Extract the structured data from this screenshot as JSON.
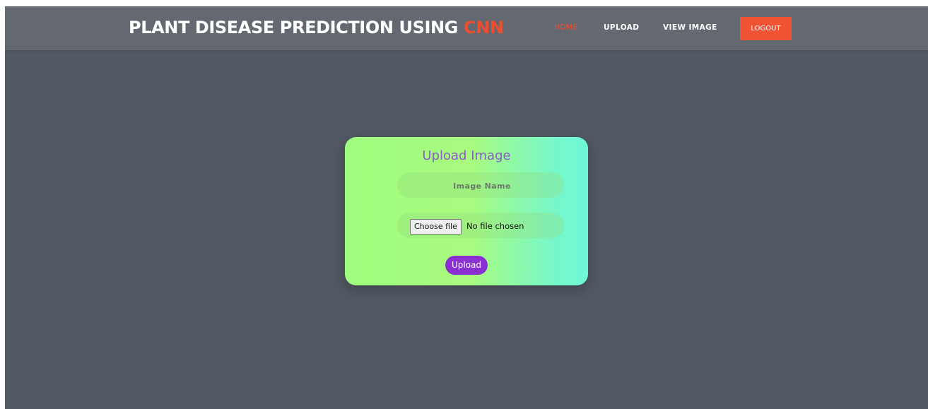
{
  "header": {
    "brand_text": "PLANT DISEASE PREDICTION USING ",
    "brand_accent": "CNN",
    "nav": {
      "home": "HOME",
      "upload": "UPLOAD",
      "view_image": "VIEW IMAGE",
      "logout": "LOGOUT"
    }
  },
  "upload_card": {
    "title": "Upload Image",
    "image_name_placeholder": "Image Name",
    "choose_file_label": "Choose file",
    "file_status": "No file chosen",
    "upload_button": "Upload"
  },
  "colors": {
    "accent": "#ee4e2e",
    "page_bg": "#525964",
    "header_bg": "#636871",
    "upload_button": "#8a2fd1",
    "card_gradient_start": "#9ffc7c",
    "card_gradient_end": "#6ef8d8"
  }
}
